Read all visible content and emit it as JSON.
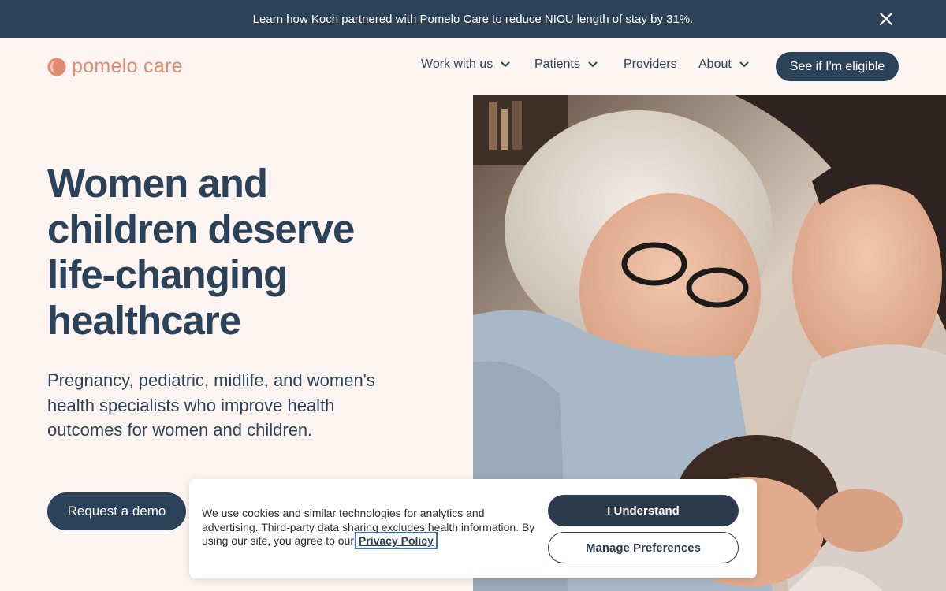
{
  "banner": {
    "text": "Learn how Koch partnered with Pomelo Care to reduce NICU length of stay by 31%.",
    "close_icon": "close-icon"
  },
  "nav": {
    "logo_text": "pomelo care",
    "logo_icon": "pomelo-logo-icon",
    "items": [
      {
        "label": "Work with us",
        "has_dropdown": true
      },
      {
        "label": "Patients",
        "has_dropdown": true
      },
      {
        "label": "Providers",
        "has_dropdown": false
      },
      {
        "label": "About",
        "has_dropdown": true
      }
    ],
    "cta_label": "See if I'm eligible"
  },
  "hero": {
    "title": "Women and children deserve life-changing healthcare",
    "subtitle": "Pregnancy, pediatric, midlife, and women's health specialists who improve health outcomes for women and children.",
    "cta_label": "Request a demo"
  },
  "cookie_banner": {
    "text": "We use cookies and similar technologies for analytics and advertising. Third-party data sharing excludes health information. By using our site, you agree to our",
    "privacy_link": "Privacy Policy",
    "accept_label": "I Understand",
    "manage_label": "Manage Preferences"
  },
  "colors": {
    "navy": "#2c4259",
    "brand_coral": "#e08a70",
    "background": "#fbf4f0"
  }
}
